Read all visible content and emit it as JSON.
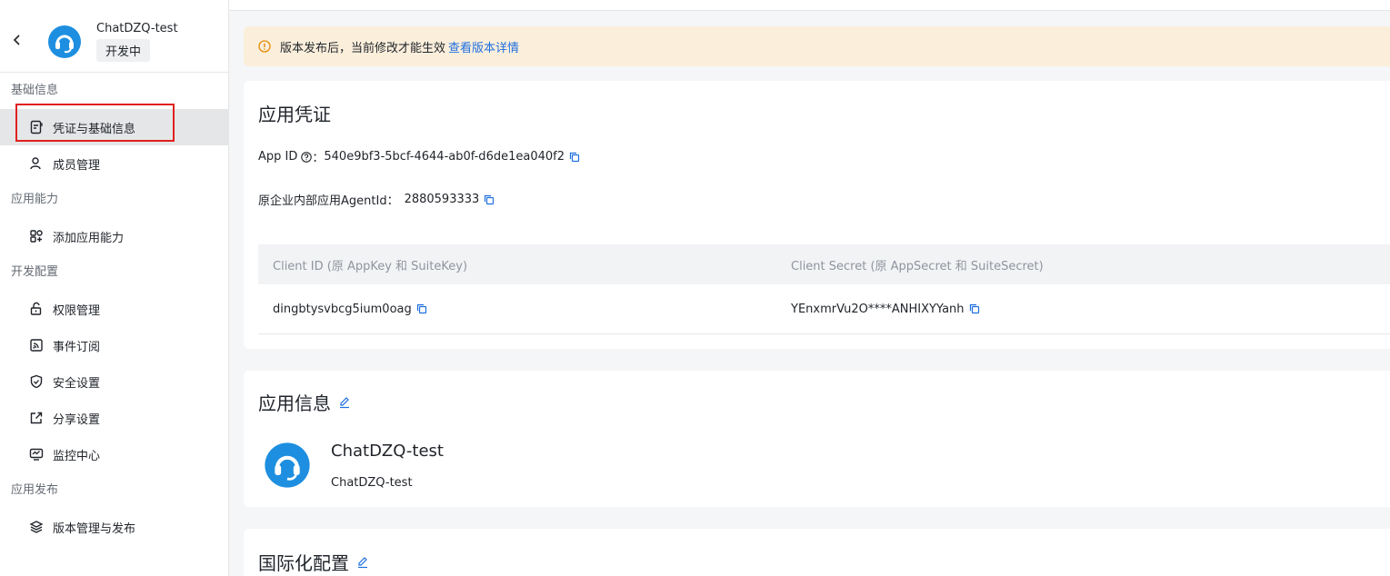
{
  "app": {
    "name": "ChatDZQ-test",
    "status": "开发中"
  },
  "sidebar": {
    "groups": [
      {
        "label": "基础信息"
      },
      {
        "label": "应用能力"
      },
      {
        "label": "开发配置"
      },
      {
        "label": "应用发布"
      }
    ],
    "items": [
      {
        "label": "凭证与基础信息",
        "icon": "document-icon",
        "active": true
      },
      {
        "label": "成员管理",
        "icon": "user-icon"
      },
      {
        "label": "添加应用能力",
        "icon": "grid-plus-icon"
      },
      {
        "label": "权限管理",
        "icon": "lock-icon"
      },
      {
        "label": "事件订阅",
        "icon": "rss-icon"
      },
      {
        "label": "安全设置",
        "icon": "shield-icon"
      },
      {
        "label": "分享设置",
        "icon": "share-icon"
      },
      {
        "label": "监控中心",
        "icon": "monitor-icon"
      },
      {
        "label": "版本管理与发布",
        "icon": "layers-icon"
      }
    ]
  },
  "notice": {
    "text": "版本发布后，当前修改才能生效",
    "link": "查看版本详情"
  },
  "credentials": {
    "title": "应用凭证",
    "app_id_label": "App ID",
    "app_id_sep": "：",
    "app_id": "540e9bf3-5bcf-4644-ab0f-d6de1ea040f2",
    "agent_label": "原企业内部应用AgentId：",
    "agent_id": "2880593333",
    "table": {
      "headers": [
        "Client ID (原 AppKey 和 SuiteKey)",
        "Client Secret (原 AppSecret 和 SuiteSecret)"
      ],
      "row": [
        "dingbtysvbcg5ium0oag",
        "YEnxmrVu2O****ANHIXYYanh"
      ]
    }
  },
  "app_info": {
    "title": "应用信息",
    "name": "ChatDZQ-test",
    "desc": "ChatDZQ-test"
  },
  "i18n": {
    "title": "国际化配置"
  },
  "colors": {
    "accent": "#1f6fe0",
    "logo": "#1e8fe0",
    "notice_bg": "#fbefdc",
    "highlight": "#e0201e"
  }
}
